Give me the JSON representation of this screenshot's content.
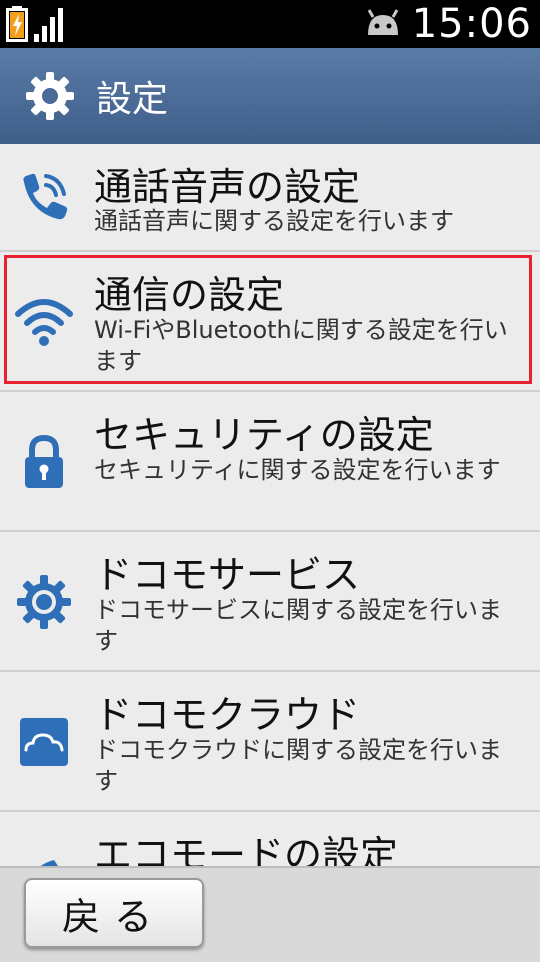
{
  "status_bar": {
    "time": "15:06",
    "icons": [
      "battery-charging-icon",
      "signal-strength-icon",
      "android-notification-icon"
    ]
  },
  "title_bar": {
    "icon": "gear-icon",
    "title": "設定"
  },
  "settings_items": [
    {
      "title": "通話音声の設定",
      "description": "通話音声に関する設定を行います",
      "icon": "phone-icon"
    },
    {
      "title": "通信の設定",
      "description": "Wi-FiやBluetoothに関する設定を行います",
      "icon": "wifi-icon",
      "highlighted": true
    },
    {
      "title": "セキュリティの設定",
      "description": "セキュリティに関する設定を行います",
      "icon": "lock-icon"
    },
    {
      "title": "ドコモサービス",
      "description": "ドコモサービスに関する設定を行います",
      "icon": "gear-service-icon"
    },
    {
      "title": "ドコモクラウド",
      "description": "ドコモクラウドに関する設定を行います",
      "icon": "cloud-icon"
    },
    {
      "title": "エコモードの設定",
      "description": "",
      "icon": "eco-mode-icon"
    }
  ],
  "bottom_bar": {
    "back_label": "戻る"
  },
  "colors": {
    "title_bar": "#4a6c98",
    "icon_blue": "#2f6fb8",
    "highlight_border": "#e8212e"
  }
}
